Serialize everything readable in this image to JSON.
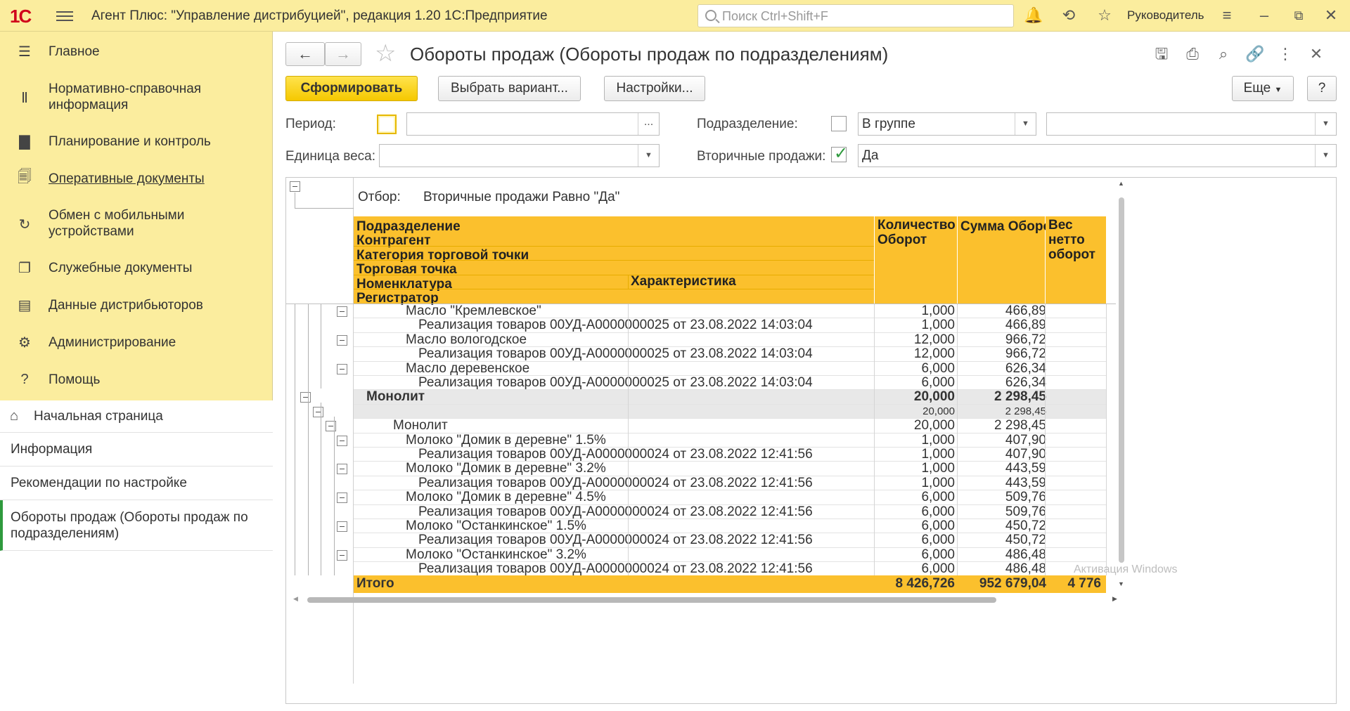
{
  "app": {
    "logo": "1С",
    "title": "Агент Плюс: \"Управление дистрибуцией\", редакция 1.20 1С:Предприятие",
    "search_placeholder": "Поиск Ctrl+Shift+F",
    "user": "Руководитель",
    "icons": [
      "bell-icon",
      "history-icon",
      "star-icon",
      "settings-icon",
      "minimize-icon",
      "restore-icon",
      "close-icon"
    ]
  },
  "sidebar": {
    "sections": [
      {
        "label": "Главное",
        "icon": "hamburger-icon"
      },
      {
        "label": "Нормативно-справочная информация",
        "icon": "library-icon"
      },
      {
        "label": "Планирование и контроль",
        "icon": "chart-icon"
      },
      {
        "label": "Оперативные документы",
        "icon": "documents-icon",
        "active": true
      },
      {
        "label": "Обмен с мобильными устройствами",
        "icon": "sync-icon"
      },
      {
        "label": "Служебные документы",
        "icon": "service-docs-icon"
      },
      {
        "label": "Данные дистрибьюторов",
        "icon": "distributor-icon"
      },
      {
        "label": "Администрирование",
        "icon": "gear-icon"
      },
      {
        "label": "Помощь",
        "icon": "help-icon"
      }
    ],
    "open_windows": [
      {
        "label": "Начальная страница",
        "icon": "home-icon"
      },
      {
        "label": "Информация"
      },
      {
        "label": "Рекомендации по настройке"
      },
      {
        "label": "Обороты продаж (Обороты продаж по подразделениям)",
        "active": true
      }
    ]
  },
  "form": {
    "title": "Обороты продаж (Обороты продаж по подразделениям)",
    "buttons": {
      "generate": "Сформировать",
      "choose_variant": "Выбрать вариант...",
      "settings": "Настройки...",
      "more": "Еще",
      "help": "?"
    },
    "filters": {
      "period_label": "Период:",
      "period_value": "",
      "period_btn": "...",
      "department_label": "Подразделение:",
      "department_mode": "В группе",
      "department_value": "",
      "weight_unit_label": "Единица веса:",
      "weight_unit_value": "",
      "secondary_label": "Вторичные продажи:",
      "secondary_value": "Да"
    }
  },
  "report": {
    "filter_label": "Отбор:",
    "filter_value": "Вторичные продажи Равно \"Да\"",
    "headers": {
      "dept": "Подразделение",
      "contractor": "Контрагент",
      "category": "Категория торговой точки",
      "outlet": "Торговая точка",
      "nomenclature": "Номенклатура",
      "characteristic": "Характеристика",
      "registrar": "Регистратор",
      "qty": "Количество Оборот",
      "sum": "Сумма Оборот",
      "weight": "Вес нетто оборот"
    },
    "rows": [
      {
        "name": "Масло \"Кремлевское\"",
        "qty": "1,000",
        "sum": "466,89",
        "level": 5,
        "box": true
      },
      {
        "name": "Реализация товаров 00УД-А0000000025 от 23.08.2022 14:03:04",
        "qty": "1,000",
        "sum": "466,89",
        "level": 6
      },
      {
        "name": "Масло вологодское",
        "qty": "12,000",
        "sum": "966,72",
        "level": 5,
        "box": true
      },
      {
        "name": "Реализация товаров 00УД-А0000000025 от 23.08.2022 14:03:04",
        "qty": "12,000",
        "sum": "966,72",
        "level": 6
      },
      {
        "name": "Масло деревенское",
        "qty": "6,000",
        "sum": "626,34",
        "level": 5,
        "box": true
      },
      {
        "name": "Реализация товаров 00УД-А0000000025 от 23.08.2022 14:03:04",
        "qty": "6,000",
        "sum": "626,34",
        "level": 6
      },
      {
        "name": "Монолит",
        "qty": "20,000",
        "sum": "2 298,45",
        "level": 2,
        "type": "grp",
        "box": true
      },
      {
        "name": "",
        "qty": "20,000",
        "sum": "2 298,45",
        "level": 3,
        "type": "grp2",
        "box": true
      },
      {
        "name": "Монолит",
        "qty": "20,000",
        "sum": "2 298,45",
        "level": 4,
        "box": true
      },
      {
        "name": "Молоко \"Домик в деревне\" 1.5%",
        "qty": "1,000",
        "sum": "407,90",
        "level": 5,
        "box": true
      },
      {
        "name": "Реализация товаров 00УД-А0000000024 от 23.08.2022 12:41:56",
        "qty": "1,000",
        "sum": "407,90",
        "level": 6
      },
      {
        "name": "Молоко \"Домик в деревне\" 3.2%",
        "qty": "1,000",
        "sum": "443,59",
        "level": 5,
        "box": true
      },
      {
        "name": "Реализация товаров 00УД-А0000000024 от 23.08.2022 12:41:56",
        "qty": "1,000",
        "sum": "443,59",
        "level": 6
      },
      {
        "name": "Молоко \"Домик в деревне\" 4.5%",
        "qty": "6,000",
        "sum": "509,76",
        "level": 5,
        "box": true
      },
      {
        "name": "Реализация товаров 00УД-А0000000024 от 23.08.2022 12:41:56",
        "qty": "6,000",
        "sum": "509,76",
        "level": 6
      },
      {
        "name": "Молоко \"Останкинское\" 1.5%",
        "qty": "6,000",
        "sum": "450,72",
        "level": 5,
        "box": true
      },
      {
        "name": "Реализация товаров 00УД-А0000000024 от 23.08.2022 12:41:56",
        "qty": "6,000",
        "sum": "450,72",
        "level": 6
      },
      {
        "name": "Молоко \"Останкинское\" 3.2%",
        "qty": "6,000",
        "sum": "486,48",
        "level": 5,
        "box": true
      },
      {
        "name": "Реализация товаров 00УД-А0000000024 от 23.08.2022 12:41:56",
        "qty": "6,000",
        "sum": "486,48",
        "level": 6
      }
    ],
    "total": {
      "label": "Итого",
      "qty": "8 426,726",
      "sum": "952 679,04",
      "weight": "4 776"
    }
  },
  "watermark": "Активация Windows",
  "colors": {
    "accent_yellow": "#fbc02d",
    "panel": "#fbed9e",
    "active_marker": "#2e9a3d",
    "logo_red": "#d0021b"
  }
}
